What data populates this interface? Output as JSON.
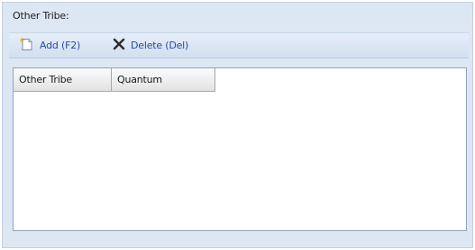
{
  "panel": {
    "title": "Other Tribe:"
  },
  "toolbar": {
    "add_label": "Add (F2)",
    "add_icon": "new-document-icon",
    "delete_label": "Delete (Del)",
    "delete_icon": "delete-x-icon"
  },
  "grid": {
    "columns": [
      {
        "label": "Other Tribe"
      },
      {
        "label": "Quantum"
      }
    ],
    "rows": []
  },
  "colors": {
    "panel_background": "#dde7f4",
    "toolbar_text": "#1f4e9c",
    "grid_border": "#8ea3c1"
  }
}
